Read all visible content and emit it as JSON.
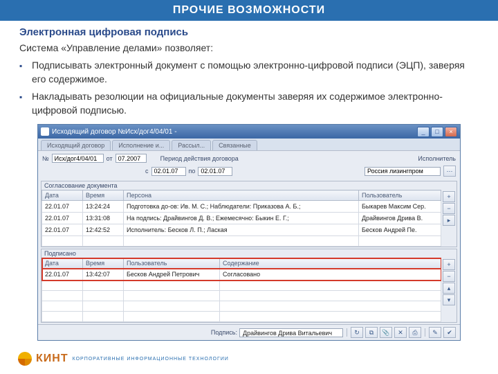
{
  "slide": {
    "header": "ПРОЧИЕ ВОЗМОЖНОСТИ",
    "subtitle": "Электронная цифровая подпись",
    "intro": "Система «Управление делами» позволяет:",
    "bullets": [
      "Подписывать электронный документ с помощью электронно-цифровой подписи (ЭЦП), заверяя его содержимое.",
      "Накладывать резолюции на официальные документы заверяя их содержимое электронно-цифровой подписью."
    ]
  },
  "window": {
    "title": "Исходящий договор №Исх/дог4/04/01 -",
    "tabs": [
      "Исходящий договор",
      "Исполнение и...",
      "Рассыл...",
      "Связанные"
    ],
    "fields": {
      "num_label": "№",
      "num_value": "Исх/дог4/04/01",
      "ot_label": "от",
      "ot_value": "07.2007",
      "period_label": "Период действия договора",
      "s_label": "с",
      "s_value": "02.01.07",
      "po_label": "по",
      "po_value": "02.01.07",
      "isp_label": "Исполнитель",
      "isp_value": "Россия лизингпром"
    },
    "grid1": {
      "title": "Согласование документа",
      "cols": [
        "Дата",
        "Время",
        "Персона",
        "Пользователь"
      ],
      "rows": [
        [
          "22.01.07",
          "13:24:24",
          "Подготовка до-ов: Ив. М. С.; Наблюдатели: Приказова А. Б.;",
          "Быкарев Максим Сер."
        ],
        [
          "22.01.07",
          "13:31:08",
          "На подпись: Драйвингов Д. В.; Ежемесячно: Быкин Е. Г.;",
          "Драйвингов Дрива В."
        ],
        [
          "22.01.07",
          "12:42:52",
          "Исполнитель: Бесков Л. П.; Лаская",
          "Бесков Андрей Пе."
        ]
      ]
    },
    "grid2": {
      "title": "Подписано",
      "cols": [
        "Дата",
        "Время",
        "Пользователь",
        "Содержание"
      ],
      "rows": [
        [
          "22.01.07",
          "13:42:07",
          "Бесков Андрей Петрович",
          "Согласовано"
        ]
      ]
    },
    "status_label": "Подпись:",
    "status_value": "Драйвингов Дрива Витальевич"
  },
  "logo": {
    "text": "КИНТ",
    "sub": "КОРПОРАТИВНЫЕ ИНФОРМАЦИОННЫЕ ТЕХНОЛОГИИ"
  }
}
